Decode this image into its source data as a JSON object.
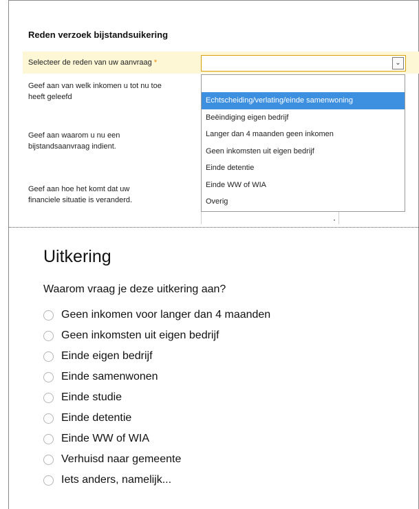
{
  "old_form": {
    "section_title": "Reden verzoek bijstandsuikering",
    "reason_label": "Selecteer de reden van uw aanvraag",
    "required_mark": "*",
    "select_value": "",
    "field_labels": [
      [
        "Geef aan van welk inkomen u tot nu toe",
        "heeft geleefd"
      ],
      [
        "Geef aan waarom u nu een",
        "bijstandsaanvraag indient."
      ],
      [
        "Geef aan hoe het komt dat uw",
        "financiele situatie is veranderd."
      ]
    ],
    "dropdown_options": [
      "Echtscheiding/verlating/einde samenwoning",
      "Beëindiging eigen bedrijf",
      "Langer dan 4 maanden geen inkomen",
      "Geen inkomsten uit eigen bedrijf",
      "Einde detentie",
      "Einde WW of WIA",
      "Overig"
    ],
    "highlighted_option": "Echtscheiding/verlating/einde samenwoning"
  },
  "new_form": {
    "title": "Uitkering",
    "question": "Waarom vraag je deze uitkering aan?",
    "options": [
      "Geen inkomen voor langer dan 4 maanden",
      "Geen inkomsten uit eigen bedrijf",
      "Einde eigen bedrijf",
      "Einde samenwonen",
      "Einde studie",
      "Einde detentie",
      "Einde WW of WIA",
      "Verhuisd naar gemeente",
      "Iets anders, namelijk..."
    ]
  },
  "colors": {
    "highlight_row": "#fdf7d6",
    "active_option": "#3d8fe0",
    "select_border": "#d8a000",
    "required": "#e68a00"
  },
  "icons": {
    "select_arrow": "chevron-down-icon",
    "radio": "radio-empty-icon"
  }
}
